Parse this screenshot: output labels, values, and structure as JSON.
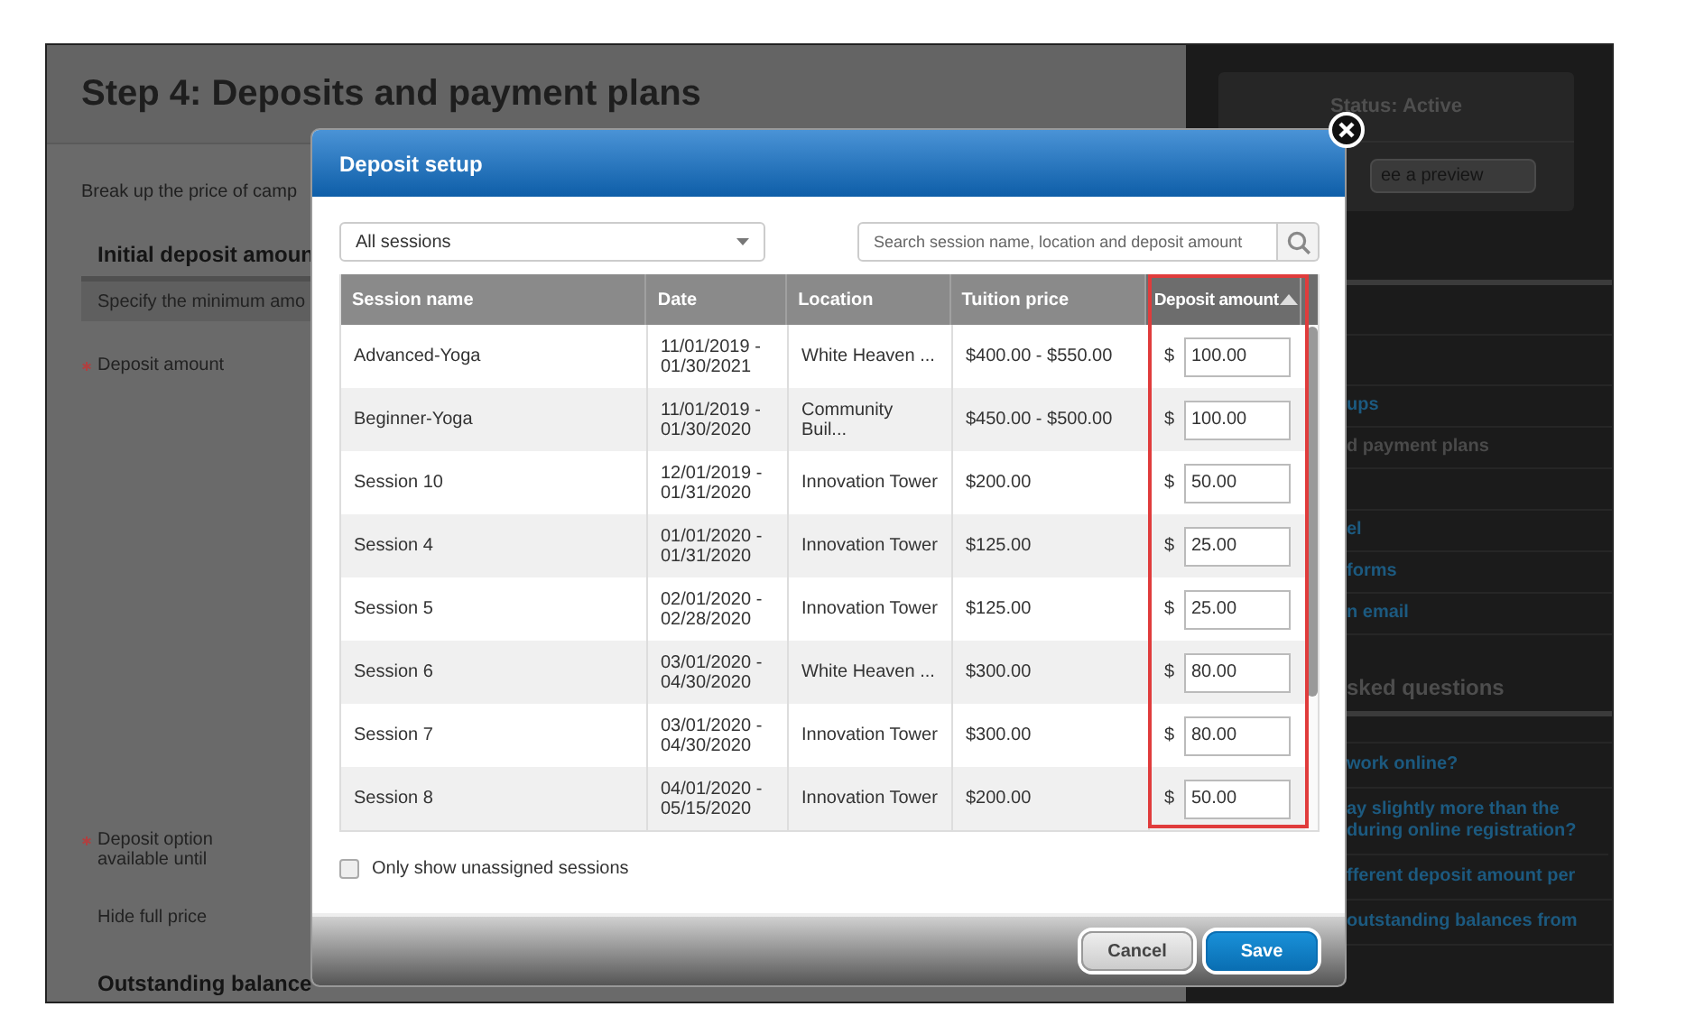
{
  "page": {
    "title": "Step 4: Deposits and payment plans",
    "intro": "Break up the price of camp",
    "section_title": "Initial deposit amoun",
    "section_hint": "Specify the minimum amo",
    "fields": [
      {
        "label": "Deposit amount",
        "required": true
      },
      {
        "label": "Deposit option available until",
        "required": true
      },
      {
        "label": "Hide full price",
        "required": false
      }
    ],
    "next_section": "Outstanding balance"
  },
  "sidebar": {
    "status": "Status: Active",
    "preview_button": "ee a preview",
    "nav_groups": [
      {
        "items": [
          {
            "label": "ups",
            "selected": false
          },
          {
            "label": "d payment plans",
            "selected": true
          }
        ]
      },
      {
        "items": [
          {
            "label": "el",
            "selected": false
          },
          {
            "label": "forms",
            "selected": false
          },
          {
            "label": "n email",
            "selected": false
          }
        ]
      }
    ],
    "faq_title": "sked questions",
    "faq_items": [
      "work online?",
      "ay slightly more than the during online registration?",
      "fferent deposit amount per",
      "outstanding balances from"
    ]
  },
  "dialog": {
    "title": "Deposit setup",
    "filter": {
      "value": "All sessions"
    },
    "search": {
      "placeholder": "Search session name, location and deposit amount"
    },
    "table": {
      "columns": [
        {
          "label": "Session name"
        },
        {
          "label": "Date"
        },
        {
          "label": "Location"
        },
        {
          "label": "Tuition price"
        },
        {
          "label": "Deposit amount",
          "sorted": true,
          "highlighted": true
        }
      ],
      "rows": [
        {
          "session": "Advanced-Yoga",
          "date": "11/01/2019 - 01/30/2021",
          "location": "White Heaven ...",
          "price": "$400.00 - $550.00",
          "currency": "$",
          "deposit": "100.00"
        },
        {
          "session": "Beginner-Yoga",
          "date": "11/01/2019 - 01/30/2020",
          "location": "Community Buil...",
          "price": "$450.00 - $500.00",
          "currency": "$",
          "deposit": "100.00"
        },
        {
          "session": "Session 10",
          "date": "12/01/2019 - 01/31/2020",
          "location": "Innovation Tower",
          "price": "$200.00",
          "currency": "$",
          "deposit": "50.00"
        },
        {
          "session": "Session 4",
          "date": "01/01/2020 - 01/31/2020",
          "location": "Innovation Tower",
          "price": "$125.00",
          "currency": "$",
          "deposit": "25.00"
        },
        {
          "session": "Session 5",
          "date": "02/01/2020 - 02/28/2020",
          "location": "Innovation Tower",
          "price": "$125.00",
          "currency": "$",
          "deposit": "25.00"
        },
        {
          "session": "Session 6",
          "date": "03/01/2020 - 04/30/2020",
          "location": "White Heaven ...",
          "price": "$300.00",
          "currency": "$",
          "deposit": "80.00"
        },
        {
          "session": "Session 7",
          "date": "03/01/2020 - 04/30/2020",
          "location": "Innovation Tower",
          "price": "$300.00",
          "currency": "$",
          "deposit": "80.00"
        },
        {
          "session": "Session 8",
          "date": "04/01/2020 - 05/15/2020",
          "location": "Innovation Tower",
          "price": "$200.00",
          "currency": "$",
          "deposit": "50.00"
        }
      ]
    },
    "unassigned_only": {
      "label": "Only show unassigned sessions",
      "checked": false
    },
    "buttons": [
      {
        "label": "Cancel",
        "kind": "secondary"
      },
      {
        "label": "Save",
        "kind": "primary"
      }
    ]
  }
}
